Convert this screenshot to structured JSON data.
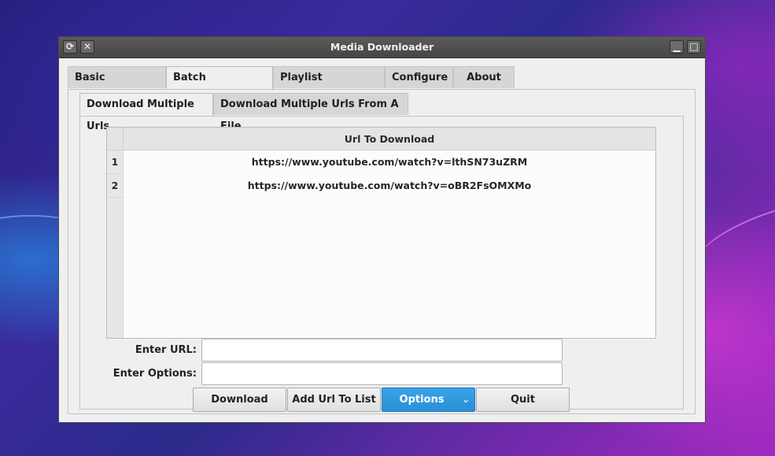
{
  "window": {
    "title": "Media Downloader",
    "titlebar_icons": [
      "restore-icon",
      "close-icon",
      "minimize-icon",
      "maximize-icon"
    ]
  },
  "main_tabs": [
    {
      "label": "Basic Downloader"
    },
    {
      "label": "Batch Downloader"
    },
    {
      "label": "Playlist Downloader"
    },
    {
      "label": "Configure"
    },
    {
      "label": "About"
    }
  ],
  "sub_tabs": [
    {
      "label": "Download Multiple Urls"
    },
    {
      "label": "Download Multiple Urls From A File"
    }
  ],
  "url_table": {
    "header": "Url To Download",
    "rows": [
      {
        "num": "1",
        "url": "https://www.youtube.com/watch?v=lthSN73uZRM"
      },
      {
        "num": "2",
        "url": "https://www.youtube.com/watch?v=oBR2FsOMXMo"
      }
    ]
  },
  "form": {
    "url_label": "Enter URL:",
    "url_value": "",
    "options_label": "Enter Options:",
    "options_value": ""
  },
  "buttons": {
    "download": "Download",
    "add_url": "Add Url To List",
    "options": "Options",
    "quit": "Quit"
  },
  "colors": {
    "accent": "#2a8fd6",
    "titlebar": "#4f4f4f"
  }
}
